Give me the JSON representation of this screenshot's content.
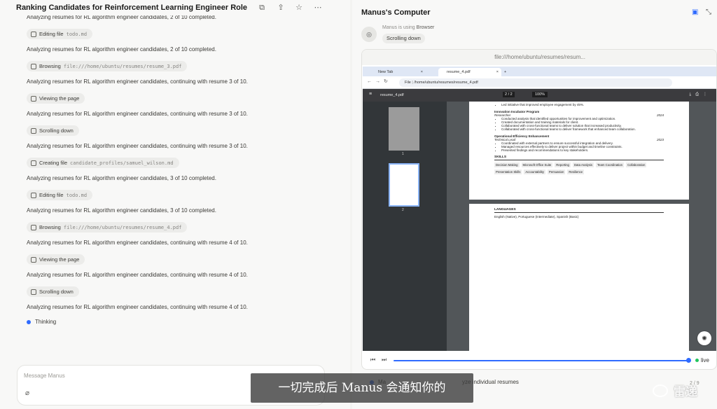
{
  "chat": {
    "title": "Ranking Candidates for Reinforcement Learning Engineer Role",
    "feed": [
      {
        "kind": "msg",
        "text": "Analyzing resumes for RL algorithm engineer candidates, 2 of 10 completed."
      },
      {
        "kind": "chip",
        "icon": "edit-icon",
        "label": "Editing file",
        "arg": "todo.md"
      },
      {
        "kind": "msg",
        "text": "Analyzing resumes for RL algorithm engineer candidates, 2 of 10 completed."
      },
      {
        "kind": "chip",
        "icon": "globe-icon",
        "label": "Browsing",
        "arg": "file:///home/ubuntu/resumes/resume_3.pdf"
      },
      {
        "kind": "msg",
        "text": "Analyzing resumes for RL algorithm engineer candidates, continuing with resume 3 of 10."
      },
      {
        "kind": "chip",
        "icon": "globe-icon",
        "label": "Viewing the page",
        "arg": ""
      },
      {
        "kind": "msg",
        "text": "Analyzing resumes for RL algorithm engineer candidates, continuing with resume 3 of 10."
      },
      {
        "kind": "chip",
        "icon": "globe-icon",
        "label": "Scrolling down",
        "arg": ""
      },
      {
        "kind": "msg",
        "text": "Analyzing resumes for RL algorithm engineer candidates, continuing with resume 3 of 10."
      },
      {
        "kind": "chip",
        "icon": "edit-icon",
        "label": "Creating file",
        "arg": "candidate_profiles/samuel_wilson.md"
      },
      {
        "kind": "msg",
        "text": "Analyzing resumes for RL algorithm engineer candidates, 3 of 10 completed."
      },
      {
        "kind": "chip",
        "icon": "edit-icon",
        "label": "Editing file",
        "arg": "todo.md"
      },
      {
        "kind": "msg",
        "text": "Analyzing resumes for RL algorithm engineer candidates, 3 of 10 completed."
      },
      {
        "kind": "chip",
        "icon": "globe-icon",
        "label": "Browsing",
        "arg": "file:///home/ubuntu/resumes/resume_4.pdf"
      },
      {
        "kind": "msg",
        "text": "Analyzing resumes for RL algorithm engineer candidates, continuing with resume 4 of 10."
      },
      {
        "kind": "chip",
        "icon": "globe-icon",
        "label": "Viewing the page",
        "arg": ""
      },
      {
        "kind": "msg",
        "text": "Analyzing resumes for RL algorithm engineer candidates, continuing with resume 4 of 10."
      },
      {
        "kind": "chip",
        "icon": "globe-icon",
        "label": "Scrolling down",
        "arg": ""
      },
      {
        "kind": "msg",
        "text": "Analyzing resumes for RL algorithm engineer candidates, continuing with resume 4 of 10."
      }
    ],
    "thinking": "Thinking",
    "composer_placeholder": "Message Manus"
  },
  "computer": {
    "title": "Manus's Computer",
    "using_prefix": "Manus is using",
    "using_app": "Browser",
    "current_action": "Scrolling down",
    "url_bar": "file:///home/ubuntu/resumes/resum...",
    "browser": {
      "tabs": [
        "New Tab",
        "resume_4.pdf"
      ],
      "address_label": "File",
      "address": "/home/ubuntu/resumes/resume_4.pdf",
      "pdf_name": "resume_4.pdf",
      "page_current": "2",
      "page_total": "2",
      "zoom": "100%",
      "thumb_numbers": [
        "1",
        "2"
      ]
    },
    "resume": {
      "top_bullet": "Led initiative that improved employee engagement by 45%.",
      "jobs": [
        {
          "org": "Innovation Incubator Program",
          "role": "Researcher",
          "year": "2024",
          "bullets": [
            "Conducted analysis that identified opportunities for improvement and optimization.",
            "Created documentation and training materials for client.",
            "Collaborated with cross-functional teams to deliver solution that increased productivity.",
            "Collaborated with cross-functional teams to deliver framework that enhanced team collaboration."
          ]
        },
        {
          "org": "Operational Efficiency Enhancement",
          "role": "Technical Lead",
          "year": "2023",
          "bullets": [
            "Coordinated with external partners to ensure successful integration and delivery.",
            "Managed resources effectively to deliver project within budget and timeline constraints.",
            "Presented findings and recommendations to key stakeholders."
          ]
        }
      ],
      "skills_heading": "SKILLS",
      "skills": [
        "Decision Making",
        "Microsoft Office Suite",
        "Reporting",
        "Data Analysis",
        "Team Coordination",
        "Collaboration",
        "Presentation Skills",
        "Accountability",
        "Persuasion",
        "Resilience"
      ],
      "languages_heading": "LANGUAGES",
      "languages": "English (Native), Portuguese (Intermediate), Spanish (Basic)"
    },
    "live_label": "live"
  },
  "task_line": {
    "prefix": "Ma",
    "suffix": "yze individual resumes",
    "count": "2 / 9"
  },
  "caption": "一切完成后 Manus 会通知你的",
  "watermark": "雷递",
  "colors": {
    "accent": "#2f6bff",
    "live": "#22c55e"
  }
}
